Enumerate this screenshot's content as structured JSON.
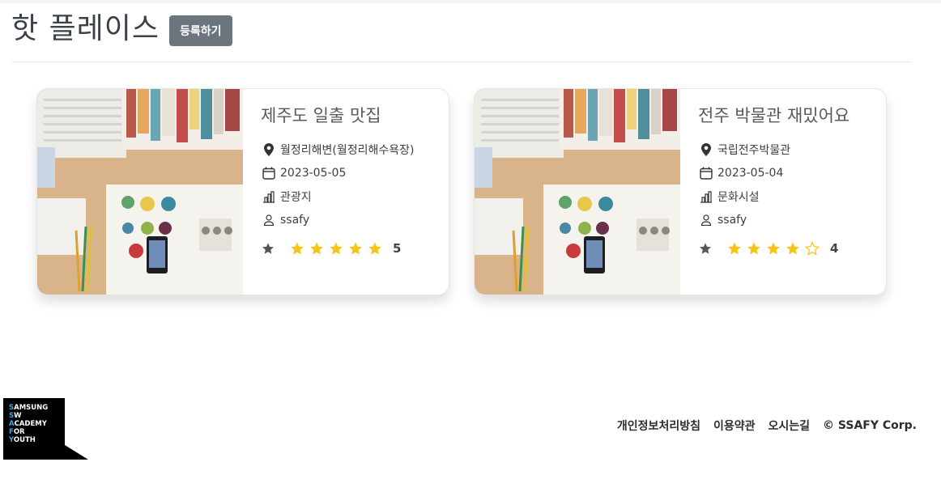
{
  "header": {
    "title": "핫 플레이스",
    "register_label": "등록하기"
  },
  "cards": [
    {
      "title": "제주도 일출 맛집",
      "location": "월정리해변(월정리해수욕장)",
      "date": "2023-05-05",
      "category": "관광지",
      "author": "ssafy",
      "rating": 5,
      "rating_text": "5",
      "image_alt": "desk with laptop, books and phone"
    },
    {
      "title": "전주 박물관 재밌어요",
      "location": "국립전주박물관",
      "date": "2023-05-04",
      "category": "문화시설",
      "author": "ssafy",
      "rating": 4,
      "rating_text": "4",
      "image_alt": "desk with laptop, books and phone"
    }
  ],
  "footer": {
    "logo_lines": [
      "SAMSUNG",
      "SW",
      "ACADEMY",
      "FOR",
      "YOUTH"
    ],
    "links": [
      "개인정보처리방침",
      "이용약관",
      "오시는길"
    ],
    "copyright": "© SSAFY Corp."
  },
  "colors": {
    "star": "#f5c518",
    "button": "#6c757d",
    "text": "#3b4148"
  },
  "icons": [
    "location-pin-icon",
    "calendar-icon",
    "building-icon",
    "user-icon",
    "star-icon"
  ]
}
